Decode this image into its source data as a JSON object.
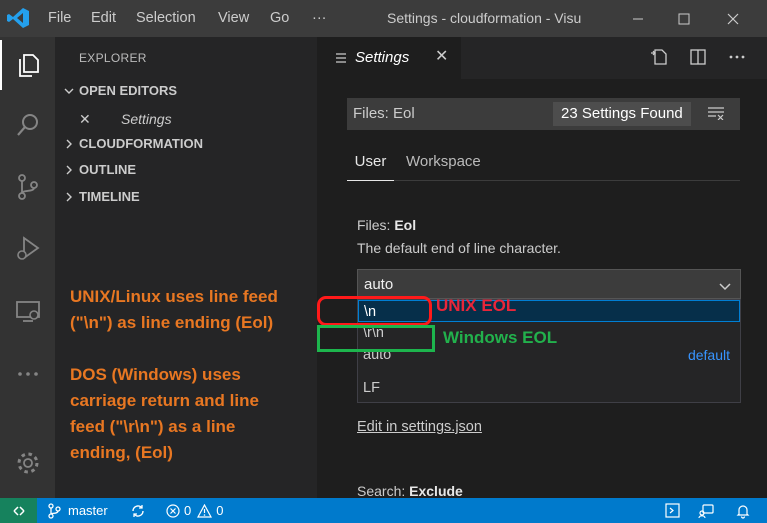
{
  "titlebar": {
    "menu": [
      "File",
      "Edit",
      "Selection",
      "View",
      "Go"
    ],
    "more": "···",
    "title": "Settings - cloudformation - Visu"
  },
  "sidebar": {
    "title": "EXPLORER",
    "sections": [
      {
        "label": "OPEN EDITORS",
        "expanded": true
      },
      {
        "label": "CLOUDFORMATION",
        "expanded": false
      },
      {
        "label": "OUTLINE",
        "expanded": false
      },
      {
        "label": "TIMELINE",
        "expanded": false
      }
    ],
    "open_editor": {
      "close": "✕",
      "label": "Settings"
    }
  },
  "annotations": {
    "unix_line1": "UNIX/Linux uses line feed",
    "unix_line2": "(\"\\n\")  as line ending (Eol)",
    "dos_line1": "DOS (Windows) uses",
    "dos_line2": "carriage return and line",
    "dos_line3": "feed (\"\\r\\n\") as a line",
    "dos_line4": "ending,  (Eol)",
    "unix_eol": "UNIX  EOL",
    "windows_eol": "Windows EOL"
  },
  "editor": {
    "tab": {
      "label": "Settings",
      "close": "✕"
    },
    "search": {
      "value": "Files: Eol",
      "count": "23 Settings Found"
    },
    "scope_tabs": [
      "User",
      "Workspace"
    ],
    "setting": {
      "prefix": "Files: ",
      "name": "Eol",
      "description": "The default end of line character.",
      "selected": "auto",
      "options": [
        {
          "label": "\\n",
          "tag": ""
        },
        {
          "label": "\\r\\n",
          "tag": ""
        },
        {
          "label": "auto",
          "tag": "default"
        }
      ],
      "option_description": "LF"
    },
    "edit_link": "Edit in settings.json",
    "next_setting": {
      "prefix": "Search: ",
      "name": "Exclude"
    }
  },
  "statusbar": {
    "branch": "master",
    "errors": "0",
    "warnings": "0"
  },
  "colors": {
    "accent": "#007acc",
    "annotation": "#e87722",
    "unix_box": "#ff1a1a",
    "windows_box": "#1db54d"
  }
}
